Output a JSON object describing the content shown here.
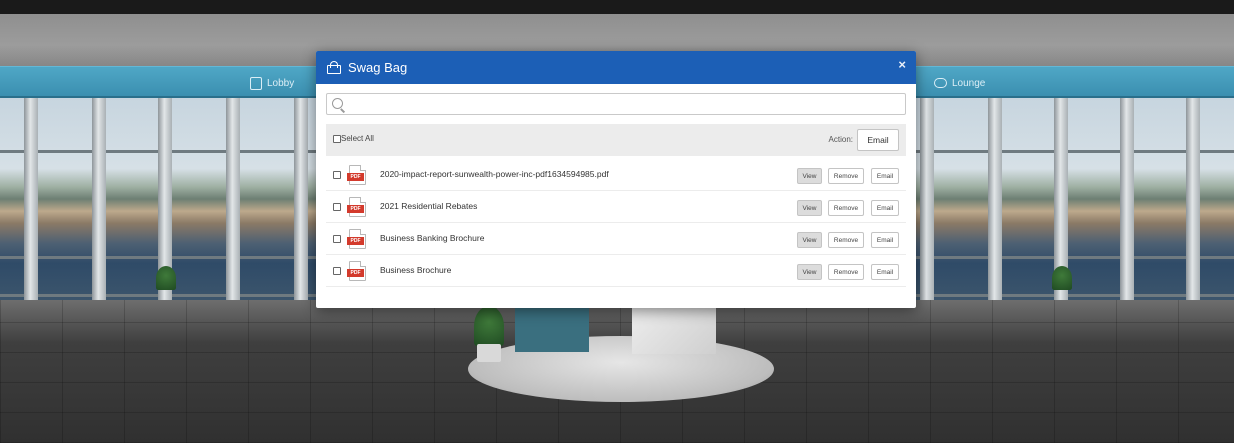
{
  "nav": {
    "lobby": "Lobby",
    "lounge": "Lounge"
  },
  "modal": {
    "title": "Swag Bag",
    "close_glyph": "×",
    "search_placeholder": "",
    "select_all_label": "Select All",
    "action_label": "Action:",
    "email_action_label": "Email",
    "files": [
      {
        "name": "2020-impact-report-sunwealth-power-inc-pdf1634594985.pdf",
        "type_badge": "PDF",
        "view_label": "View",
        "remove_label": "Remove",
        "email_label": "Email"
      },
      {
        "name": "2021 Residential Rebates",
        "type_badge": "PDF",
        "view_label": "View",
        "remove_label": "Remove",
        "email_label": "Email"
      },
      {
        "name": "Business Banking Brochure",
        "type_badge": "PDF",
        "view_label": "View",
        "remove_label": "Remove",
        "email_label": "Email"
      },
      {
        "name": "Business Brochure",
        "type_badge": "PDF",
        "view_label": "View",
        "remove_label": "Remove",
        "email_label": "Email"
      }
    ]
  },
  "colors": {
    "header_blue": "#1c5fb6",
    "nav_band": "#4fa7c6",
    "pdf_red": "#d33a2c"
  },
  "icons": {
    "bag": "shopping-bag-icon",
    "close": "close-icon",
    "search": "search-icon",
    "file": "pdf-file-icon",
    "lobby": "lobby-icon",
    "lounge": "chat-icon"
  }
}
